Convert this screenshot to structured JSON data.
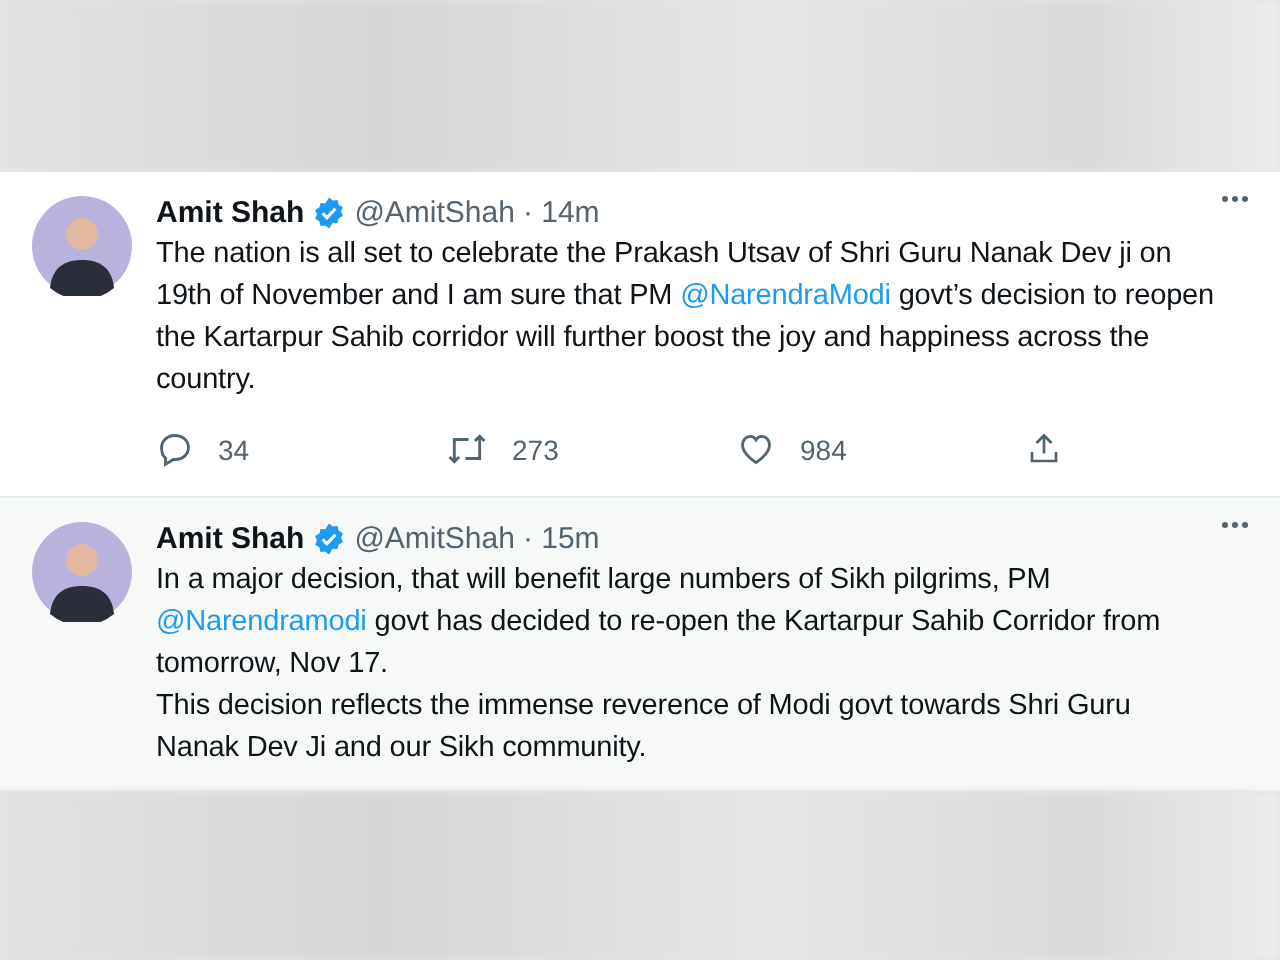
{
  "tweets": [
    {
      "name": "Amit Shah",
      "handle": "@AmitShah",
      "time": "· 14m",
      "verified": true,
      "paragraphs": [
        [
          {
            "kind": "plain",
            "text": "The nation is all set to celebrate the Prakash Utsav of Shri Guru Nanak Dev ji on 19th of November and I am sure that PM "
          },
          {
            "kind": "mention",
            "text": "@NarendraModi"
          },
          {
            "kind": "plain",
            "text": " govt’s decision to reopen the Kartarpur Sahib corridor will further boost the joy and happiness across the country."
          }
        ]
      ],
      "actions": [
        {
          "kind": "reply",
          "count": "34"
        },
        {
          "kind": "retweet",
          "count": "273"
        },
        {
          "kind": "like",
          "count": "984"
        },
        {
          "kind": "share"
        }
      ]
    },
    {
      "name": "Amit Shah",
      "handle": "@AmitShah",
      "time": "· 15m",
      "verified": true,
      "paragraphs": [
        [
          {
            "kind": "plain",
            "text": "In a major decision, that will benefit large numbers of Sikh pilgrims, PM "
          },
          {
            "kind": "mention",
            "text": "@Narendramodi"
          },
          {
            "kind": "plain",
            "text": " govt has decided to re-open the Kartarpur Sahib Corridor from tomorrow, Nov 17."
          }
        ],
        [
          {
            "kind": "plain",
            "text": "This decision reflects the immense reverence of Modi govt towards Shri Guru Nanak Dev Ji and our Sikh community."
          }
        ]
      ]
    }
  ]
}
